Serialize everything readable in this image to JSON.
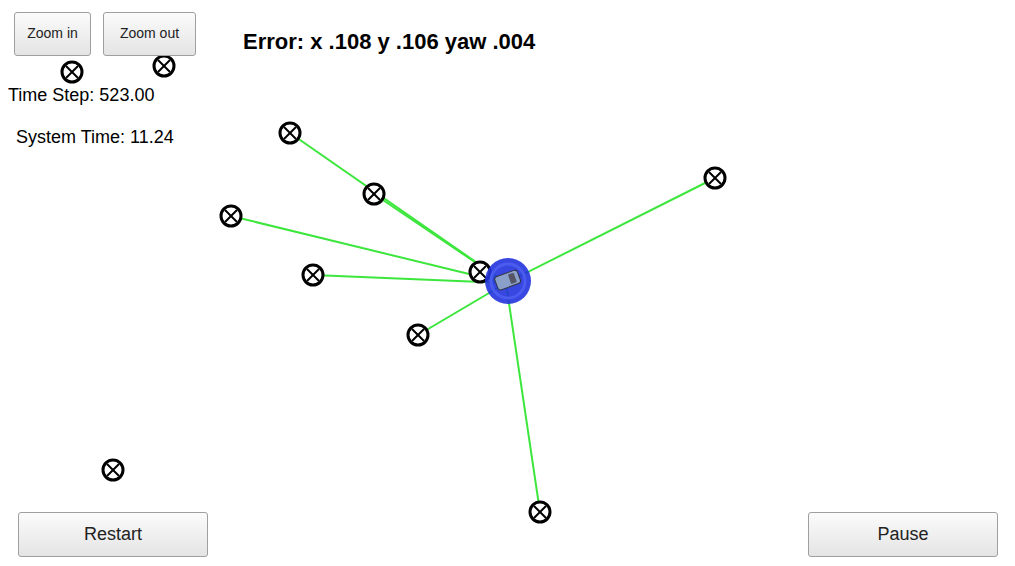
{
  "toolbar": {
    "buttons": [
      {
        "label": "Zoom in"
      },
      {
        "label": "Zoom out"
      }
    ]
  },
  "error": "Error: x .108 y .106 yaw .004",
  "time_step": "Time Step: 523.00",
  "system_time": "System Time: 11.24",
  "landmarks": [
    {
      "observed": false
    },
    {
      "observed": false
    },
    {
      "observed": true
    },
    {
      "observed": true
    },
    {
      "observed": true
    },
    {
      "observed": true
    },
    {
      "observed": true
    },
    {
      "observed": true
    },
    {
      "observed": true
    },
    {
      "observed": false
    },
    {
      "observed": true
    }
  ],
  "controls": [
    "Restart",
    "Pause"
  ]
}
